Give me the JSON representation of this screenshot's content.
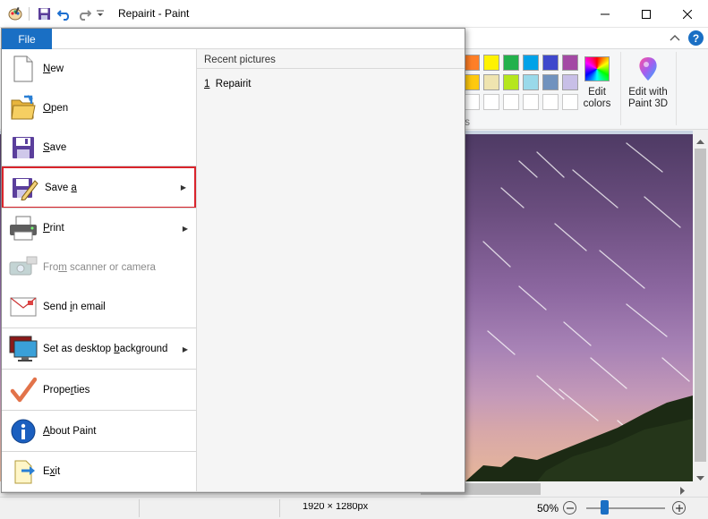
{
  "window": {
    "title": "Repairit - Paint"
  },
  "quick_access": {
    "icons": [
      "paint-app-icon",
      "save-icon",
      "undo-icon",
      "redo-icon",
      "customize-dropdown-icon"
    ]
  },
  "ribbon": {
    "colors_group_label": "ors",
    "edit_colors_label_1": "Edit",
    "edit_colors_label_2": "colors",
    "paint3d_label_1": "Edit with",
    "paint3d_label_2": "Paint 3D",
    "palette_row1": [
      "#ff7f27",
      "#fff200",
      "#22b14c",
      "#00a2e8",
      "#3f48cc",
      "#a349a4"
    ],
    "palette_row2": [
      "#ffc90e",
      "#efe4b0",
      "#b5e61d",
      "#99d9ea",
      "#7092be",
      "#c8bfe7"
    ]
  },
  "file_menu": {
    "tab_label": "File",
    "items": [
      {
        "key": "N",
        "rest": "ew",
        "pre": "",
        "icon": "new-document-icon",
        "submenu": false,
        "disabled": false
      },
      {
        "key": "O",
        "rest": "pen",
        "pre": "",
        "icon": "open-folder-icon",
        "submenu": false,
        "disabled": false
      },
      {
        "key": "S",
        "rest": "ave",
        "pre": "",
        "icon": "save-icon",
        "submenu": false,
        "disabled": false
      },
      {
        "key": "a",
        "rest": "",
        "pre": "Save ",
        "icon": "save-as-icon",
        "submenu": true,
        "disabled": false
      },
      {
        "key": "P",
        "rest": "rint",
        "pre": "",
        "icon": "printer-icon",
        "submenu": true,
        "disabled": false
      },
      {
        "key": "m",
        "rest": " scanner or camera",
        "pre": "Fro",
        "icon": "scanner-icon",
        "submenu": false,
        "disabled": true
      },
      {
        "key": "i",
        "rest": "n email",
        "pre": "Send ",
        "icon": "email-icon",
        "submenu": false,
        "disabled": false
      },
      {
        "key": "b",
        "rest": "ackground",
        "pre": "Set as desktop ",
        "icon": "desktop-background-icon",
        "submenu": true,
        "disabled": false
      },
      {
        "key": "r",
        "rest": "ties",
        "pre": "Prope",
        "icon": "properties-checkmark-icon",
        "submenu": false,
        "disabled": false
      },
      {
        "key": "A",
        "rest": "bout Paint",
        "pre": "",
        "icon": "info-icon",
        "submenu": false,
        "disabled": false
      },
      {
        "key": "x",
        "rest": "it",
        "pre": "E",
        "icon": "exit-icon",
        "submenu": false,
        "disabled": false
      }
    ],
    "recent_header": "Recent pictures",
    "recent_items": [
      {
        "num": "1",
        "name": "Repairit"
      }
    ]
  },
  "status": {
    "dimensions": "1920 × 1280px",
    "zoom": "50%"
  },
  "colors": {
    "file_tab": "#1a6fc4",
    "highlight_border": "#d9242c",
    "help": "#1a6fc4"
  }
}
